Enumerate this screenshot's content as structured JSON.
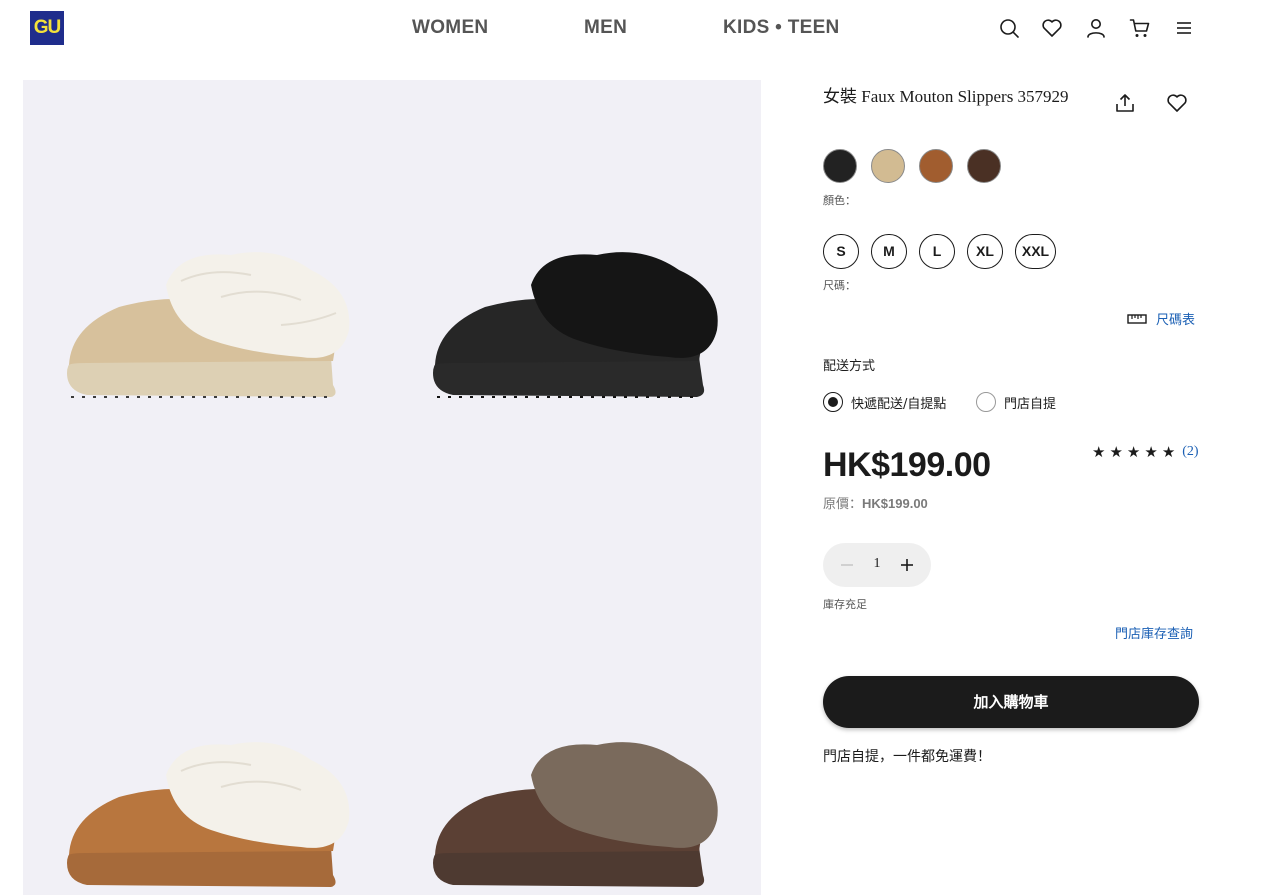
{
  "header": {
    "logo": "GU",
    "nav": [
      "WOMEN",
      "MEN",
      "KIDS • TEEN"
    ],
    "icons": [
      "search-icon",
      "heart-icon",
      "user-icon",
      "cart-icon",
      "menu-icon"
    ]
  },
  "gallery": {
    "images": [
      {
        "name": "beige-slipper",
        "fur": "#f4f1ea",
        "body": "#d7c19c",
        "sole": "#ddd0b4"
      },
      {
        "name": "black-slipper",
        "fur": "#151515",
        "body": "#262626",
        "sole": "#2a2a2a"
      },
      {
        "name": "camel-slipper",
        "fur": "#f4f1ea",
        "body": "#b8763e",
        "sole": "#a66a3a"
      },
      {
        "name": "brown-slipper",
        "fur": "#7a6a5c",
        "body": "#5b4034",
        "sole": "#4e3a31"
      }
    ]
  },
  "product": {
    "title": "女裝 Faux Mouton Slippers 357929",
    "colors": [
      {
        "name": "black",
        "hex": "#222222"
      },
      {
        "name": "beige",
        "hex": "#d2bb92"
      },
      {
        "name": "camel",
        "hex": "#a15d2f"
      },
      {
        "name": "dark-brown",
        "hex": "#4a3024"
      }
    ],
    "color_label": "顏色：",
    "sizes": [
      "S",
      "M",
      "L",
      "XL",
      "XXL"
    ],
    "size_label": "尺碼：",
    "size_chart_label": "尺碼表",
    "delivery_label": "配送方式",
    "delivery_options": [
      {
        "label": "快遞配送/自提點",
        "selected": true
      },
      {
        "label": "門店自提",
        "selected": false
      }
    ],
    "price": "HK$199.00",
    "original_price_label": "原價：",
    "original_price": "HK$199.00",
    "rating": {
      "stars": 5,
      "reviews": "(2)"
    },
    "quantity": "1",
    "stock_status": "庫存充足",
    "store_stock_link": "門店庫存查詢",
    "add_to_cart": "加入購物車",
    "promo": "門店自提，一件都免運費！"
  },
  "colors": {
    "accent_link": "#1a5fb4",
    "primary": "#1b1b1b",
    "logo_bg": "#1f2d8c",
    "logo_text": "#f4e23a",
    "gallery_bg": "#f1f0f6"
  }
}
